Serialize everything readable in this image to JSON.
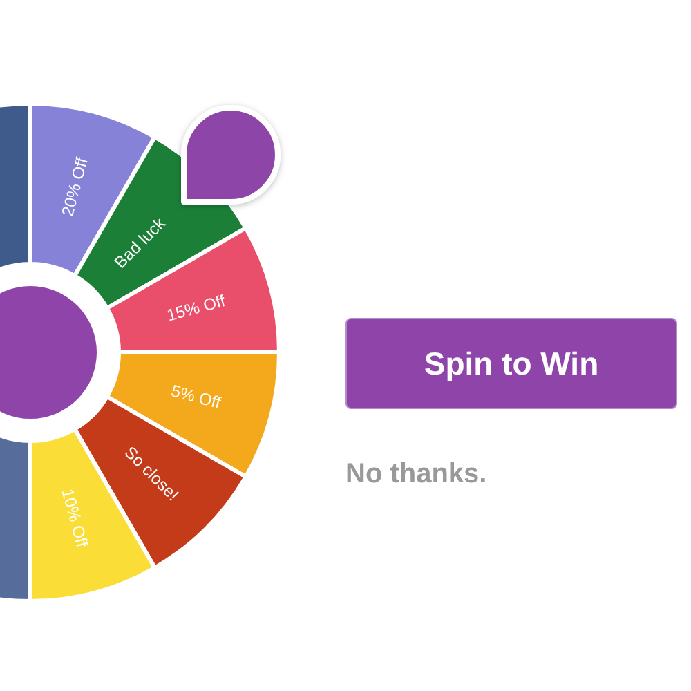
{
  "wheel": {
    "segments": [
      {
        "color": "#3f5b8c"
      },
      {
        "label": "20% Off",
        "color": "#8582d8"
      },
      {
        "label": "Bad luck",
        "color": "#1b7f38"
      },
      {
        "label": "15% Off",
        "color": "#e94f6b"
      },
      {
        "label": "5% Off",
        "color": "#f4a81c"
      },
      {
        "label": "So close!",
        "color": "#c43b1a"
      },
      {
        "label": "10% Off",
        "color": "#fbdd38"
      },
      {
        "color": "#566c9a"
      }
    ]
  },
  "spin_button": {
    "label": "Spin to Win"
  },
  "decline_link": {
    "label": "No thanks."
  }
}
